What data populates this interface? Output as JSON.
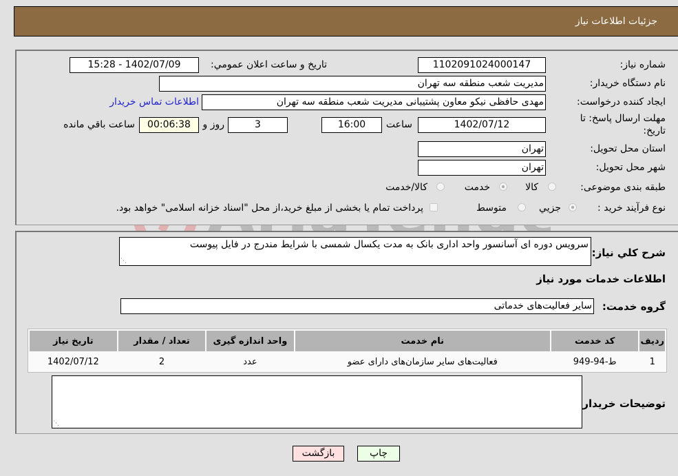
{
  "header": {
    "title": "جزئیات اطلاعات نیاز"
  },
  "form": {
    "need_number": {
      "label": "شماره نیاز:",
      "value": "1102091024000147"
    },
    "announce": {
      "label": "تاریخ و ساعت اعلان عمومي:",
      "value": "1402/07/09 - 15:28"
    },
    "buyer_org": {
      "label": "نام دستگاه خریدار:",
      "value": "مدیریت شعب منطقه سه تهران"
    },
    "creator": {
      "label": "ایجاد کننده درخواست:",
      "value": "مهدی حافظی نیکو معاون پشتیبانی مدیریت شعب منطقه سه تهران"
    },
    "contact_link": "اطلاعات تماس خریدار",
    "deadline": {
      "label_line1": "مهلت ارسال پاسخ: تا",
      "label_line2": "تاریخ:",
      "date": "1402/07/12",
      "time_label": "ساعت",
      "time": "16:00",
      "days": "3",
      "days_label": "روز و",
      "remaining": "00:06:38",
      "remaining_label": "ساعت باقي مانده"
    },
    "province": {
      "label": "استان محل تحویل:",
      "value": "تهران"
    },
    "city": {
      "label": "شهر محل تحویل:",
      "value": "تهران"
    },
    "category": {
      "label": "طبقه بندی موضوعی:",
      "options": [
        "کالا",
        "خدمت",
        "کالا/خدمت"
      ],
      "selected": "خدمت"
    },
    "process": {
      "label": "نوع فرآیند خرید :",
      "options": [
        "جزيي",
        "متوسط"
      ],
      "selected": "جزيي",
      "treasury_note": "پرداخت تمام یا بخشی از مبلغ خرید،از محل \"اسناد خزانه اسلامی\" خواهد بود."
    }
  },
  "details": {
    "summary_label": "شرح کلي نياز:",
    "summary_value": "سرویس دوره ای آسانسور واحد اداری بانک به مدت یکسال شمسی با شرایط مندرج در فایل پیوست",
    "services_heading": "اطلاعات خدمات مورد نیاز",
    "service_group_label": "گروه خدمت:",
    "service_group_value": "سایر فعالیت‌های خدماتی",
    "table": {
      "headers": [
        "ردیف",
        "کد خدمت",
        "نام خدمت",
        "واحد اندازه گیری",
        "تعداد / مقدار",
        "تاریخ نیاز"
      ],
      "rows": [
        [
          "1",
          "ط-94-949",
          "فعالیت‌های سایر سازمان‌های دارای عضو",
          "عدد",
          "2",
          "1402/07/12"
        ]
      ]
    },
    "buyer_notes_label": "توضیحات خریدار:",
    "buyer_notes_value": ""
  },
  "buttons": {
    "print": "چاپ",
    "back": "بازگشت"
  },
  "watermark": "AriaTender.neT"
}
